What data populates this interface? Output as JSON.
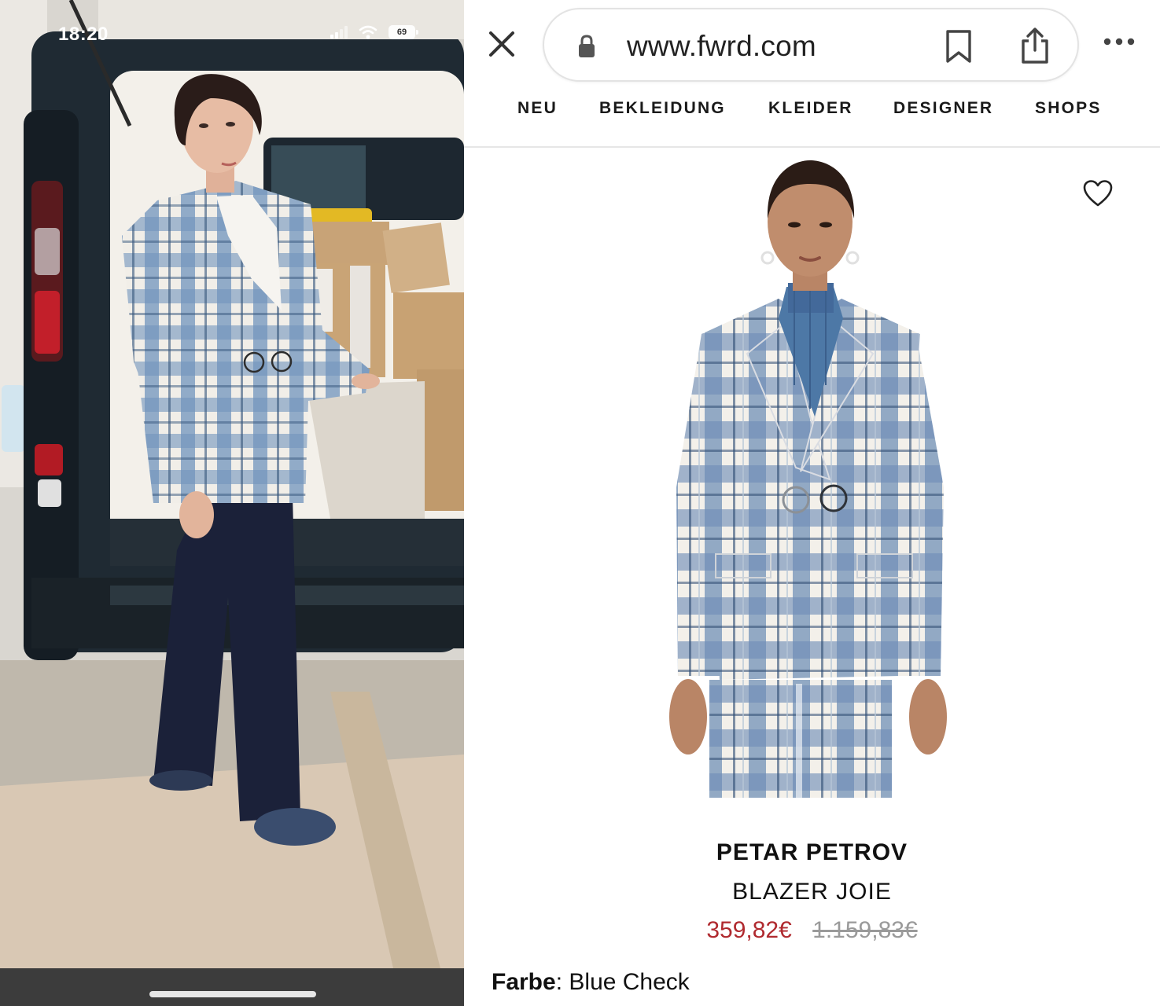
{
  "status_bar": {
    "time": "18:20",
    "battery": "69"
  },
  "browser": {
    "url": "www.fwrd.com",
    "icons": [
      "close-icon",
      "lock-icon",
      "bookmark-icon",
      "share-icon",
      "more-icon"
    ]
  },
  "site_nav": {
    "items": [
      "NEU",
      "BEKLEIDUNG",
      "KLEIDER",
      "DESIGNER",
      "SHOPS"
    ]
  },
  "product": {
    "brand": "PETAR PETROV",
    "name": "BLAZER JOIE",
    "price_sale": "359,82€",
    "price_original": "1.159,83€",
    "color_label": "Farbe",
    "color_separator": ":",
    "color_value": "Blue Check"
  },
  "colors": {
    "sale_price": "#b02a2f",
    "plaid_blue": "#6f8fb7",
    "plaid_white": "#f2efe8",
    "turtleneck": "#4d78a6",
    "van_dark": "#1f2a33"
  }
}
